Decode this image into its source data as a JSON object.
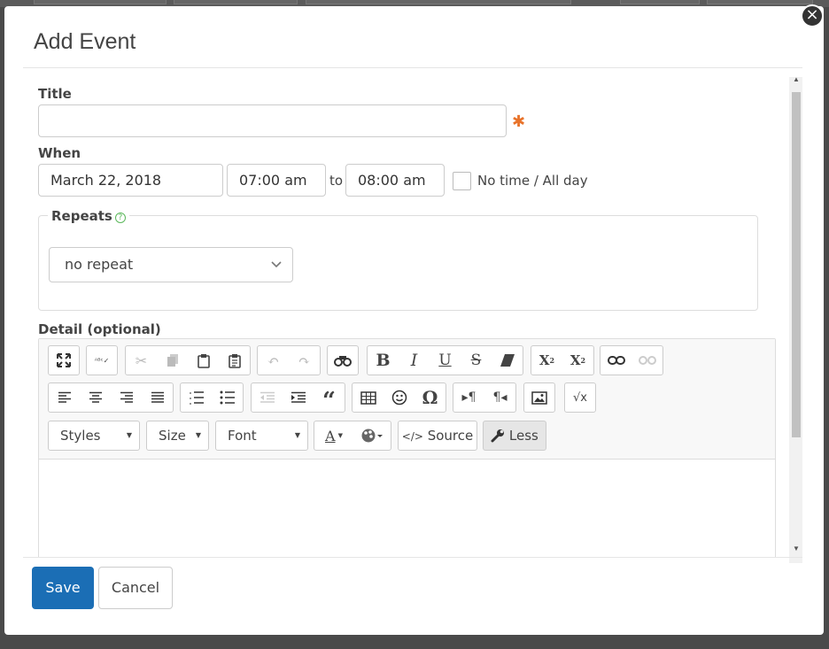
{
  "modal": {
    "title": "Add Event",
    "close_glyph": "×"
  },
  "form": {
    "title_label": "Title",
    "title_value": "",
    "required_mark": "✱",
    "when_label": "When",
    "date": "March 22, 2018",
    "start_time": "07:00 am",
    "to_text": "to",
    "end_time": "08:00 am",
    "all_day_label": "No time / All day",
    "all_day_checked": false,
    "repeats_label": "Repeats",
    "repeat_value": "no repeat",
    "detail_label": "Detail (optional)"
  },
  "toolbar": {
    "row1_icons": [
      "maximize-icon",
      "spellcheck-icon",
      "cut-icon",
      "copy-icon",
      "paste-icon",
      "paste-text-icon",
      "undo-icon",
      "redo-icon",
      "find-icon",
      "bold-icon",
      "italic-icon",
      "underline-icon",
      "strikethrough-icon",
      "remove-format-icon",
      "superscript-icon",
      "subscript-icon",
      "link-icon",
      "unlink-icon"
    ],
    "row2_icons": [
      "align-left-icon",
      "align-center-icon",
      "align-right-icon",
      "justify-icon",
      "numbered-list-icon",
      "bulleted-list-icon",
      "outdent-icon",
      "indent-icon",
      "blockquote-icon",
      "table-icon",
      "smiley-icon",
      "special-char-icon",
      "ltr-icon",
      "rtl-icon",
      "image-icon",
      "math-icon"
    ],
    "styles_label": "Styles",
    "size_label": "Size",
    "font_label": "Font",
    "source_label": "Source",
    "less_label": "Less"
  },
  "footer": {
    "save_label": "Save",
    "cancel_label": "Cancel"
  },
  "colors": {
    "primary": "#1b6eb5",
    "required": "#e8732b",
    "help": "#5cb85c"
  }
}
